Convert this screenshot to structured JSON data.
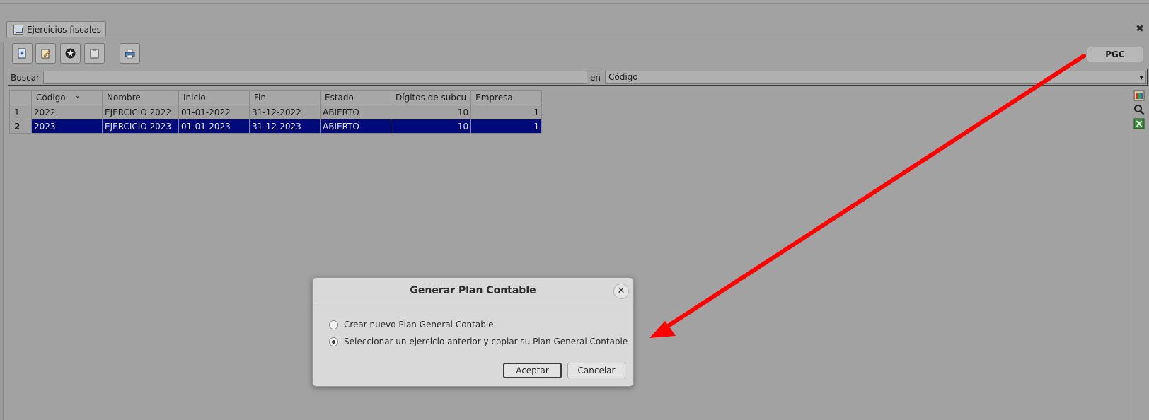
{
  "tab": {
    "label": "Ejercicios fiscales"
  },
  "toolbar": {
    "buttons": [
      "new-icon",
      "edit-icon",
      "delete-icon",
      "clipboard-icon",
      "print-icon"
    ],
    "pgc_label": "PGC"
  },
  "search": {
    "label": "Buscar",
    "value": "",
    "in_label": "en",
    "field_selected": "Código"
  },
  "table": {
    "columns": [
      "Código",
      "Nombre",
      "Inicio",
      "Fin",
      "Estado",
      "Dígitos de subcu",
      "Empresa"
    ],
    "rows": [
      {
        "num": "1",
        "cells": [
          "2022",
          "EJERCICIO 2022",
          "01-01-2022",
          "31-12-2022",
          "ABIERTO",
          "10",
          "1"
        ]
      },
      {
        "num": "2",
        "cells": [
          "2023",
          "EJERCICIO 2023",
          "01-01-2023",
          "31-12-2023",
          "ABIERTO",
          "10",
          "1"
        ],
        "selected": true
      }
    ]
  },
  "side_icons": [
    "columns-config-icon",
    "search-icon",
    "excel-export-icon"
  ],
  "dialog": {
    "title": "Generar Plan Contable",
    "options": [
      {
        "label": "Crear nuevo Plan General Contable",
        "checked": false
      },
      {
        "label": "Seleccionar un ejercicio anterior y copiar su Plan General Contable",
        "checked": true
      }
    ],
    "accept_label": "Aceptar",
    "cancel_label": "Cancelar"
  },
  "annotation": {
    "arrow_color": "#ff0000"
  },
  "colors": {
    "selection": "#000a7a",
    "background": "#a2a2a2"
  }
}
